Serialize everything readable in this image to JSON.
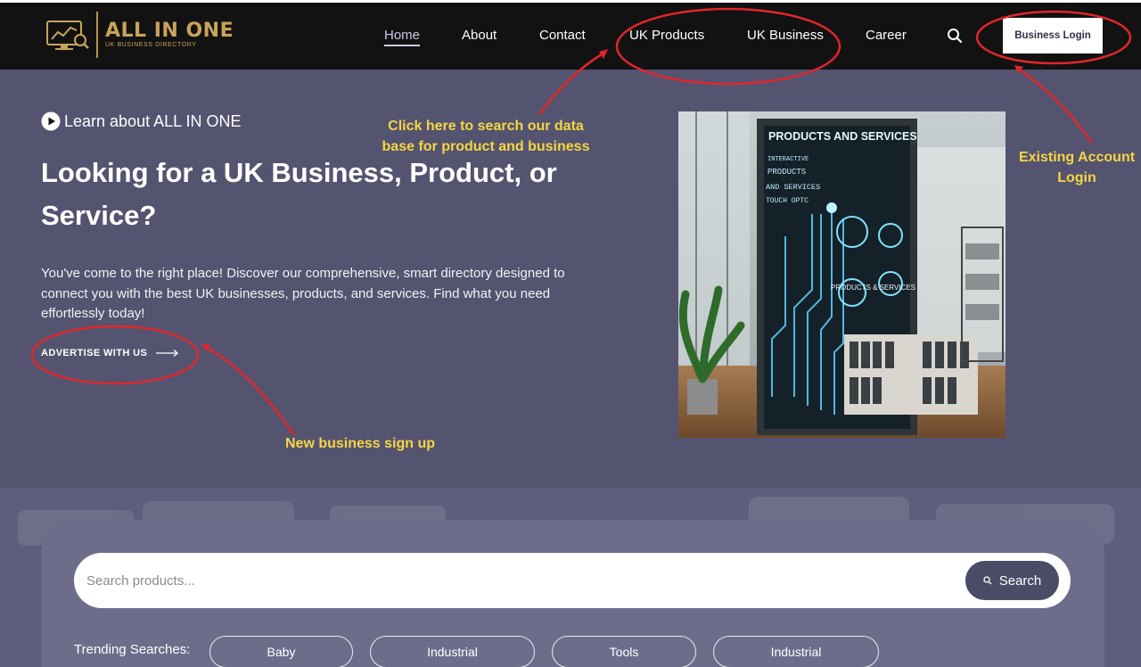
{
  "brand": {
    "title": "ALL IN ONE",
    "subtitle": "UK BUSINESS DIRECTORY",
    "gold": "#c9a35c"
  },
  "nav": {
    "items": [
      {
        "label": "Home",
        "active": true
      },
      {
        "label": "About"
      },
      {
        "label": "Contact"
      },
      {
        "label": "UK Products"
      },
      {
        "label": "UK Business"
      },
      {
        "label": "Career"
      }
    ],
    "search_icon": "search-icon",
    "login_label": "Business Login"
  },
  "hero": {
    "learn_label": "Learn about ALL IN ONE",
    "title": "Looking for a UK Business, Product, or Service?",
    "description": "You've come to the right place! Discover our comprehensive, smart directory designed to connect you with the best UK businesses, products, and services. Find what you need effortlessly today!",
    "cta_label": "ADVERTISE WITH US",
    "image_heading": "PRODUCTS AND SERVICES",
    "image_lines": [
      "INTERACTIVE",
      "PRODUCTS",
      "AND SERVICES",
      "TOUCH OPTC"
    ],
    "image_panel_text": "PRODUCTS & SERVICES"
  },
  "annotations": {
    "search_hint_line1": "Click here to search our data",
    "search_hint_line2": "base for product and business",
    "login_hint_line1": "Existing Account",
    "login_hint_line2": "Login",
    "signup_hint": "New business sign up",
    "color": "#f6d542",
    "circle_color": "#e0262b"
  },
  "search": {
    "placeholder": "Search products...",
    "button_label": "Search",
    "trending_label": "Trending Searches:",
    "trending": [
      "Baby",
      "Industrial",
      "Tools",
      "Industrial"
    ]
  }
}
